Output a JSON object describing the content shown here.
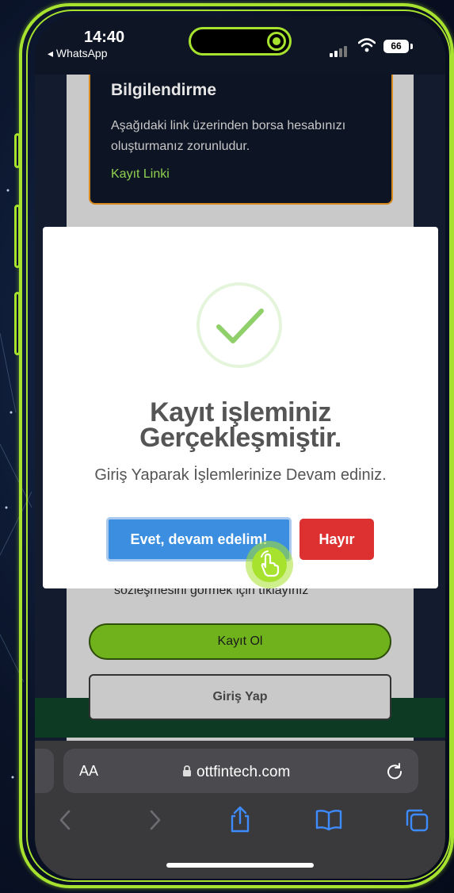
{
  "status_bar": {
    "time": "14:40",
    "back_app": "◂ WhatsApp",
    "battery": "66"
  },
  "info": {
    "title": "Bilgilendirme",
    "text": "Aşağıdaki link üzerinden borsa hesabınızı oluşturmanız zorunludur.",
    "link": "Kayıt Linki"
  },
  "page": {
    "behind_text": "sözleşmesini görmek için tıklayınız",
    "register_button": "Kayıt Ol",
    "login_button": "Giriş Yap"
  },
  "modal": {
    "title_line1": "Kayıt işleminiz",
    "title_line2": "Gerçekleşmiştir.",
    "text": "Giriş Yaparak İşlemlerinize Devam ediniz.",
    "confirm_button": "Evet, devam edelim!",
    "cancel_button": "Hayır",
    "success_color": "#8fd06a"
  },
  "browser": {
    "aa_label": "AA",
    "url": "ottfintech.com"
  },
  "colors": {
    "frame_accent": "#a6e22e",
    "confirm": "#3b8ee0",
    "cancel": "#dd3131",
    "register": "#6fb21c"
  }
}
